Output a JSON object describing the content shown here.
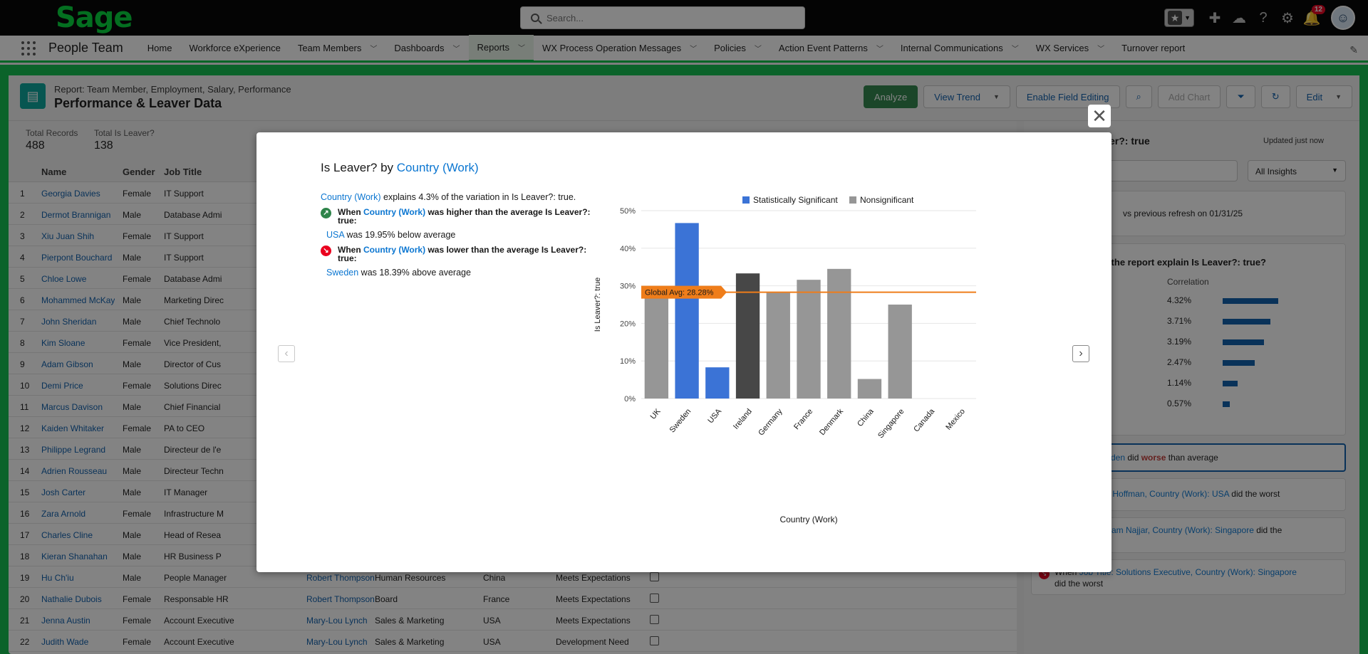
{
  "topbar": {
    "logo": "Sage",
    "search_placeholder": "Search...",
    "notification_count": "12"
  },
  "nav": {
    "app_name": "People Team",
    "items": [
      {
        "label": "Home",
        "dropdown": false
      },
      {
        "label": "Workforce eXperience",
        "dropdown": false
      },
      {
        "label": "Team Members",
        "dropdown": true
      },
      {
        "label": "Dashboards",
        "dropdown": true
      },
      {
        "label": "Reports",
        "dropdown": true,
        "active": true
      },
      {
        "label": "WX Process Operation Messages",
        "dropdown": true
      },
      {
        "label": "Policies",
        "dropdown": true
      },
      {
        "label": "Action Event Patterns",
        "dropdown": true
      },
      {
        "label": "Internal Communications",
        "dropdown": true
      },
      {
        "label": "WX Services",
        "dropdown": true
      },
      {
        "label": "Turnover report",
        "dropdown": false
      }
    ]
  },
  "report": {
    "subtitle": "Report: Team Member, Employment, Salary, Performance",
    "title": "Performance & Leaver Data",
    "buttons": {
      "analyze": "Analyze",
      "view_trend": "View Trend",
      "enable_field_editing": "Enable Field Editing",
      "add_chart": "Add Chart",
      "edit": "Edit"
    },
    "summary": {
      "total_records_label": "Total Records",
      "total_records_value": "488",
      "total_leaver_label": "Total Is Leaver?",
      "total_leaver_value": "138"
    },
    "columns": [
      "Name",
      "Gender",
      "Job Title"
    ],
    "rows": [
      {
        "n": "1",
        "name": "Georgia Davies",
        "gender": "Female",
        "job": "IT Support"
      },
      {
        "n": "2",
        "name": "Dermot Brannigan",
        "gender": "Male",
        "job": "Database Admi"
      },
      {
        "n": "3",
        "name": "Xiu Juan Shih",
        "gender": "Female",
        "job": "IT Support"
      },
      {
        "n": "4",
        "name": "Pierpont Bouchard",
        "gender": "Male",
        "job": "IT Support"
      },
      {
        "n": "5",
        "name": "Chloe Lowe",
        "gender": "Female",
        "job": "Database Admi"
      },
      {
        "n": "6",
        "name": "Mohammed McKay",
        "gender": "Male",
        "job": "Marketing Direc"
      },
      {
        "n": "7",
        "name": "John Sheridan",
        "gender": "Male",
        "job": "Chief Technolo"
      },
      {
        "n": "8",
        "name": "Kim Sloane",
        "gender": "Female",
        "job": "Vice President,"
      },
      {
        "n": "9",
        "name": "Adam Gibson",
        "gender": "Male",
        "job": "Director of Cus"
      },
      {
        "n": "10",
        "name": "Demi Price",
        "gender": "Female",
        "job": "Solutions Direc"
      },
      {
        "n": "11",
        "name": "Marcus Davison",
        "gender": "Male",
        "job": "Chief Financial"
      },
      {
        "n": "12",
        "name": "Kaiden Whitaker",
        "gender": "Female",
        "job": "PA to CEO"
      },
      {
        "n": "13",
        "name": "Philippe Legrand",
        "gender": "Male",
        "job": "Directeur de l'e"
      },
      {
        "n": "14",
        "name": "Adrien Rousseau",
        "gender": "Male",
        "job": "Directeur Techn"
      },
      {
        "n": "15",
        "name": "Josh Carter",
        "gender": "Male",
        "job": "IT Manager"
      },
      {
        "n": "16",
        "name": "Zara Arnold",
        "gender": "Female",
        "job": "Infrastructure M"
      },
      {
        "n": "17",
        "name": "Charles Cline",
        "gender": "Male",
        "job": "Head of Resea"
      },
      {
        "n": "18",
        "name": "Kieran Shanahan",
        "gender": "Male",
        "job": "HR Business P"
      },
      {
        "n": "19",
        "name": "Hu Ch'iu",
        "gender": "Male",
        "job": "People Manager",
        "manager": "Robert Thompson",
        "dept": "Human Resources",
        "country": "China",
        "perf": "Meets Expectations"
      },
      {
        "n": "20",
        "name": "Nathalie Dubois",
        "gender": "Female",
        "job": "Responsable HR",
        "manager": "Robert Thompson",
        "dept": "Board",
        "country": "France",
        "perf": "Meets Expectations"
      },
      {
        "n": "21",
        "name": "Jenna Austin",
        "gender": "Female",
        "job": "Account Executive",
        "manager": "Mary-Lou Lynch",
        "dept": "Sales & Marketing",
        "country": "USA",
        "perf": "Meets Expectations"
      },
      {
        "n": "22",
        "name": "Judith Wade",
        "gender": "Female",
        "job": "Account Executive",
        "manager": "Mary-Lou Lynch",
        "dept": "Sales & Marketing",
        "country": "USA",
        "perf": "Development Need"
      }
    ]
  },
  "insights": {
    "title": "er?: true",
    "updated": "Updated just now",
    "filter": "All Insights",
    "compare": "vs previous refresh on 01/31/25",
    "question": "n the report explain Is Leaver?: true?",
    "correlation_label": "Correlation",
    "correlations": [
      {
        "pct": "4.32%",
        "value": 4.32
      },
      {
        "pct": "3.71%",
        "value": 3.71
      },
      {
        "pct": "3.19%",
        "value": 3.19
      },
      {
        "pct": "2.47%",
        "value": 2.47
      },
      {
        "pct": "1.14%",
        "value": 1.14
      },
      {
        "pct": "0.57%",
        "value": 0.57
      }
    ],
    "partial_link": "g",
    "card1_a": "k): Sweden",
    "card1_b": " did ",
    "card1_c": "worse",
    "card1_d": " than average",
    "card2_a": "er : Jen Hoffman, Country (Work): USA",
    "card2_b": " did the worst",
    "card3_a": "er : Hayam Najjar, Country (Work): Singapore",
    "card3_b": " did the",
    "card4_a": "When ",
    "card4_b": "Job Title: Solutions Executive, Country (Work): Singapore",
    "card4_c": "did the worst"
  },
  "modal": {
    "title_prefix": "Is Leaver? by ",
    "title_field": "Country (Work)",
    "explain_field": "Country (Work)",
    "explain_text": " explains 4.3% of the variation in Is Leaver?: true.",
    "higher": {
      "prefix": "When ",
      "field": "Country (Work)",
      "suffix": " was higher than the average Is Leaver?: true:",
      "country": "USA",
      "result": " was 19.95% below average"
    },
    "lower": {
      "prefix": "When ",
      "field": "Country (Work)",
      "suffix": " was lower than the average Is Leaver?: true:",
      "country": "Sweden",
      "result": " was 18.39% above average"
    }
  },
  "colors": {
    "significant": "#3b73d6",
    "nonsignificant": "#969696",
    "highlight": "#474747",
    "average": "#ef7d1a",
    "brand_green": "#00c244"
  },
  "chart_data": {
    "type": "bar",
    "xlabel": "Country (Work)",
    "ylabel": "Is Leaver?: true",
    "ylim": [
      0,
      50
    ],
    "yticks": [
      "0%",
      "10%",
      "20%",
      "30%",
      "40%",
      "50%"
    ],
    "legend": [
      "Statistically Significant",
      "Nonsignificant"
    ],
    "legend_position": "top",
    "categories": [
      "UK",
      "Sweden",
      "USA",
      "Ireland",
      "Germany",
      "France",
      "Denmark",
      "China",
      "Singapore",
      "Canada",
      "Mexico"
    ],
    "values": [
      28.0,
      46.7,
      8.3,
      33.3,
      28.2,
      31.6,
      34.5,
      5.2,
      25.0,
      0,
      0
    ],
    "significance": [
      "non",
      "sig",
      "sig",
      "dark",
      "non",
      "non",
      "non",
      "non",
      "non",
      "non",
      "non"
    ],
    "average_label": "Global Avg: 28.28%",
    "average": 28.28
  }
}
